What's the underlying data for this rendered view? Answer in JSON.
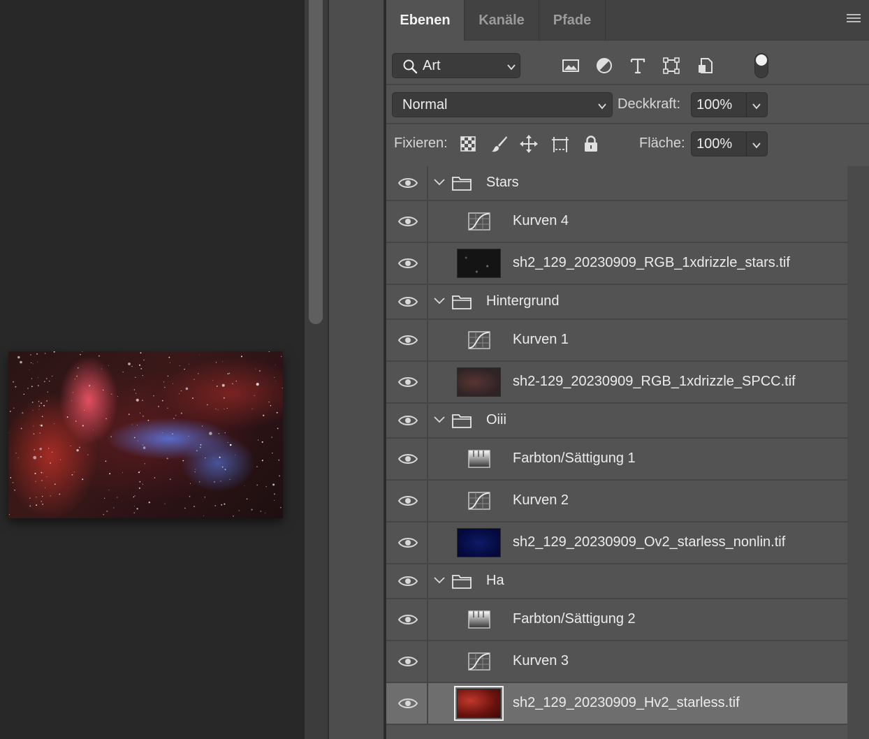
{
  "panel": {
    "tabs": [
      {
        "label": "Ebenen",
        "active": true
      },
      {
        "label": "Kanäle",
        "active": false
      },
      {
        "label": "Pfade",
        "active": false
      }
    ]
  },
  "filter": {
    "kind_label": "Art",
    "icons": [
      "image-filter-icon",
      "adjustment-filter-icon",
      "type-filter-icon",
      "shape-filter-icon",
      "smart-object-filter-icon"
    ],
    "toggle_on": true
  },
  "blend": {
    "mode": "Normal",
    "opacity_label": "Deckkraft:",
    "opacity_value": "100%"
  },
  "lock": {
    "label": "Fixieren:",
    "icons": [
      "lock-transparent-pixels-icon",
      "lock-image-pixels-icon",
      "lock-position-icon",
      "lock-artboard-icon",
      "lock-all-icon"
    ],
    "fill_label": "Fläche:",
    "fill_value": "100%"
  },
  "layers": [
    {
      "name": "Stars",
      "kind": "group",
      "visible": true
    },
    {
      "name": "Kurven 4",
      "kind": "curves",
      "visible": true
    },
    {
      "name": "sh2_129_20230909_RGB_1xdrizzle_stars.tif",
      "kind": "image",
      "thumb": "stars",
      "visible": true
    },
    {
      "name": "Hintergrund",
      "kind": "group",
      "visible": true
    },
    {
      "name": "Kurven 1",
      "kind": "curves",
      "visible": true
    },
    {
      "name": "sh2-129_20230909_RGB_1xdrizzle_SPCC.tif",
      "kind": "image",
      "thumb": "spcc",
      "visible": true
    },
    {
      "name": "Oiii",
      "kind": "group",
      "visible": true
    },
    {
      "name": "Farbton/Sättigung 1",
      "kind": "huesat",
      "visible": true
    },
    {
      "name": "Kurven 2",
      "kind": "curves",
      "visible": true
    },
    {
      "name": "sh2_129_20230909_Ov2_starless_nonlin.tif",
      "kind": "image",
      "thumb": "oiii",
      "visible": true
    },
    {
      "name": "Ha",
      "kind": "group",
      "visible": true
    },
    {
      "name": "Farbton/Sättigung 2",
      "kind": "huesat",
      "visible": true
    },
    {
      "name": "Kurven 3",
      "kind": "curves",
      "visible": true
    },
    {
      "name": "sh2_129_20230909_Hv2_starless.tif",
      "kind": "image",
      "thumb": "ha",
      "visible": true,
      "selected": true
    }
  ],
  "colors": {
    "panel_bg": "#535353",
    "selected_row": "#6e6e6e",
    "tabbar_bg": "#424242",
    "text": "#ececec"
  }
}
